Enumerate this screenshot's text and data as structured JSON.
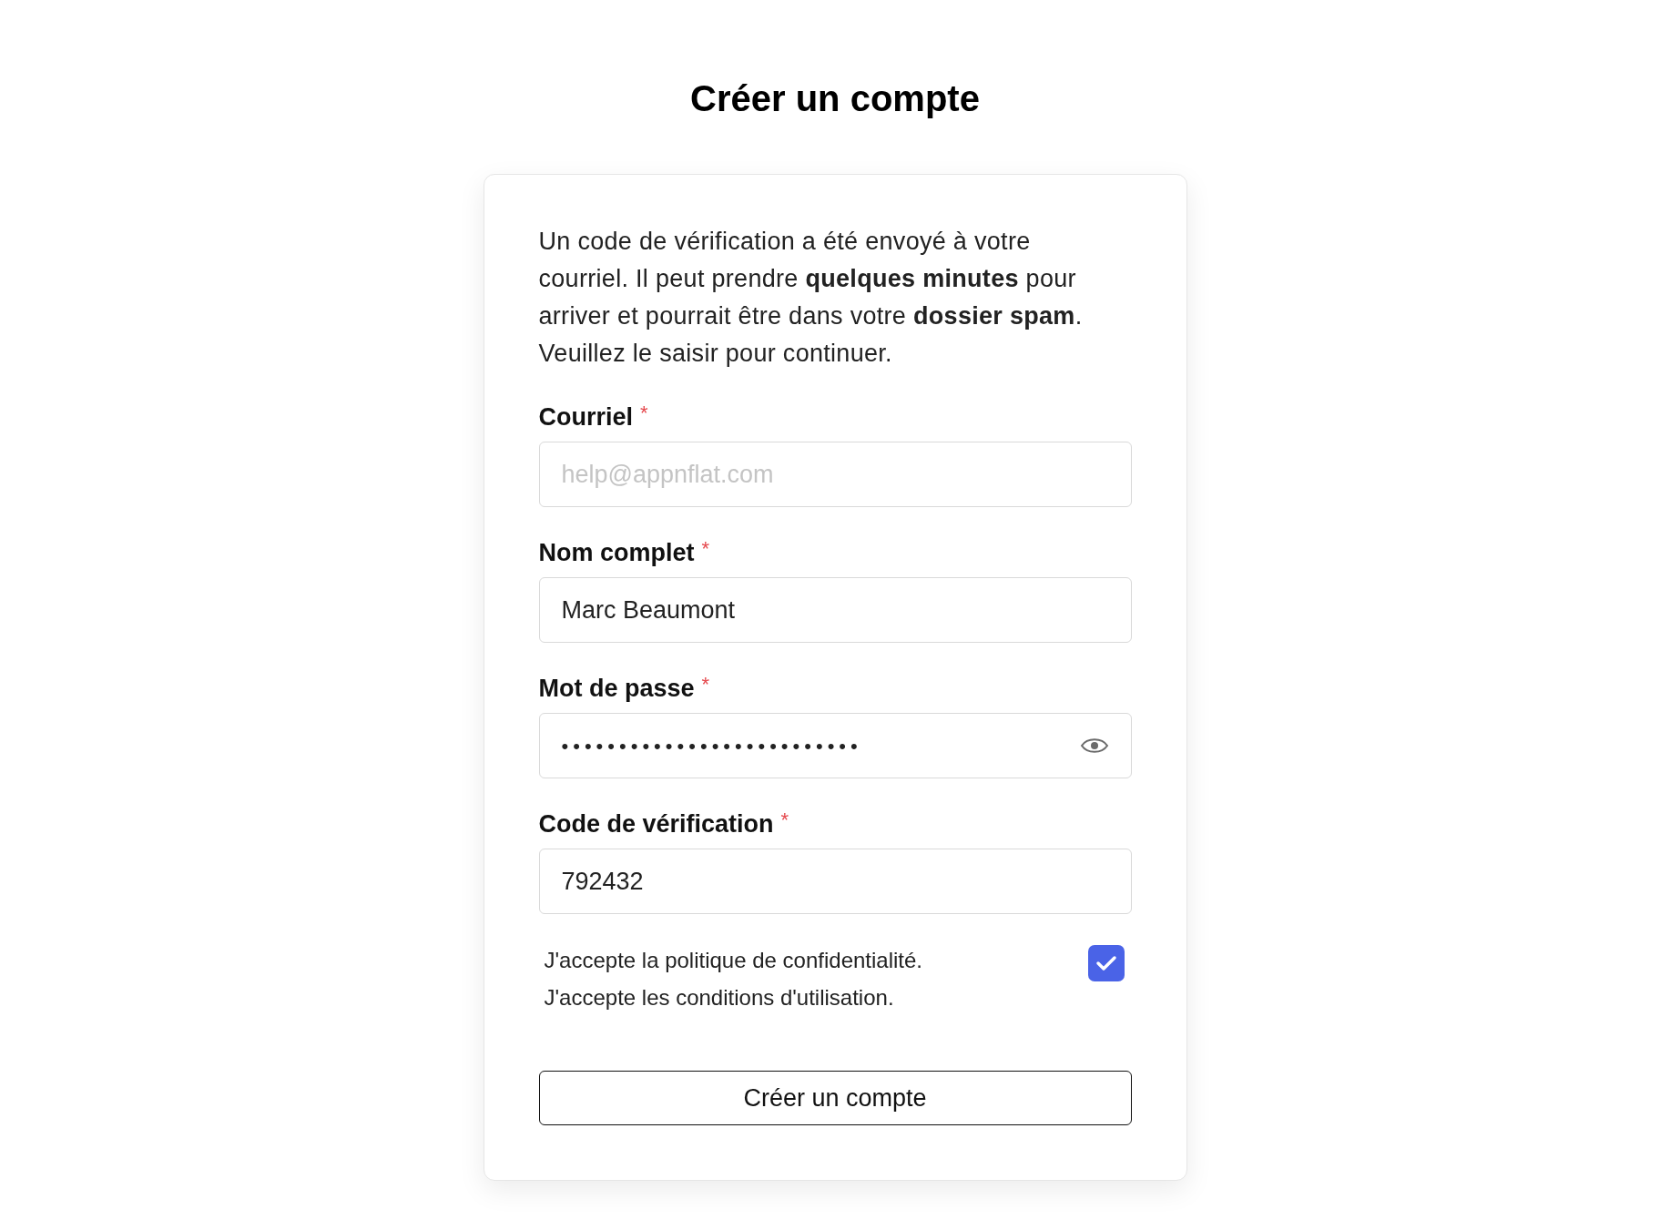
{
  "title": "Créer un compte",
  "intro": "Un code de vérification a été envoyé à votre courriel. Il peut prendre **quelques minutes** pour arriver et pourrait être dans votre **dossier spam**. Veuillez le saisir pour continuer.",
  "fields": [
    {
      "kind": "text",
      "label": "Courriel",
      "required_mark": "*",
      "placeholder": "help@appnflat.com"
    },
    {
      "kind": "text",
      "label": "Nom complet",
      "required_mark": "*",
      "value": "Marc Beaumont"
    },
    {
      "kind": "password",
      "label": "Mot de passe",
      "required_mark": "*",
      "value": "••••••••••••••••••••••••••"
    },
    {
      "kind": "text",
      "label": "Code de vérification",
      "required_mark": "*",
      "value": "792432"
    }
  ],
  "agreement": {
    "lines": [
      "J'accepte la politique de confidentialité.",
      "J'accepte les conditions d'utilisation."
    ],
    "checked": true
  },
  "submit_button": "Créer un compte"
}
